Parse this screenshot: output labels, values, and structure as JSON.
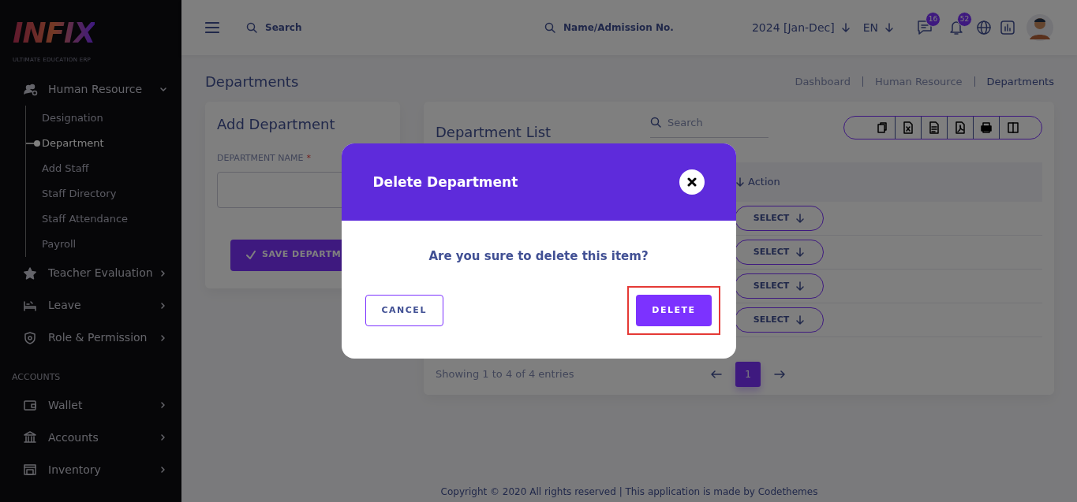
{
  "logo": {
    "name": "INFIX",
    "tagline": "ULTIMATE EDUCATION ERP"
  },
  "sidebar": {
    "groups": [
      {
        "items": [
          {
            "label": "Human Resource",
            "expanded": true,
            "children": [
              {
                "label": "Designation",
                "selected": false
              },
              {
                "label": "Department",
                "selected": true
              },
              {
                "label": "Add Staff",
                "selected": false
              },
              {
                "label": "Staff Directory",
                "selected": false
              },
              {
                "label": "Staff Attendance",
                "selected": false
              },
              {
                "label": "Payroll",
                "selected": false
              }
            ]
          },
          {
            "label": "Teacher Evaluation",
            "expanded": false
          },
          {
            "label": "Leave",
            "expanded": false
          },
          {
            "label": "Role & Permission",
            "expanded": false
          }
        ]
      },
      {
        "heading": "ACCOUNTS",
        "items": [
          {
            "label": "Wallet",
            "expanded": false
          },
          {
            "label": "Accounts",
            "expanded": false
          },
          {
            "label": "Inventory",
            "expanded": false
          }
        ]
      }
    ]
  },
  "header": {
    "search": {
      "placeholder": "Search"
    },
    "student_search": {
      "placeholder": "Name/Admission No."
    },
    "session": "2024 [Jan-Dec]",
    "language": "EN",
    "messages_count": "16",
    "notifications_count": "52"
  },
  "page": {
    "title": "Departments",
    "breadcrumb": [
      {
        "label": "Dashboard",
        "current": false
      },
      {
        "label": "Human Resource",
        "current": false
      },
      {
        "label": "Departments",
        "current": true
      }
    ]
  },
  "add_card": {
    "title": "Add Department",
    "field_label": "DEPARTMENT NAME",
    "required_mark": "*",
    "save_button": "SAVE DEPARTM"
  },
  "list_card": {
    "title": "Department List",
    "search": {
      "placeholder": "Search"
    },
    "table": {
      "columns": [
        {
          "label": "Action"
        }
      ],
      "rows": [
        {
          "action": "SELECT"
        },
        {
          "action": "SELECT"
        },
        {
          "action": "SELECT"
        },
        {
          "action": "SELECT"
        }
      ]
    },
    "info": "Showing 1 to 4 of 4 entries",
    "pages": [
      {
        "label": "1",
        "selected": true
      }
    ]
  },
  "modal": {
    "title": "Delete Department",
    "message": "Are you sure to delete this item?",
    "buttons": [
      {
        "label": "CANCEL",
        "kind": "outline",
        "highlighted": false
      },
      {
        "label": "DELETE",
        "kind": "primary",
        "highlighted": true
      }
    ]
  },
  "footer": "Copyright © 2020 All rights reserved | This application is made by Codethemes"
}
